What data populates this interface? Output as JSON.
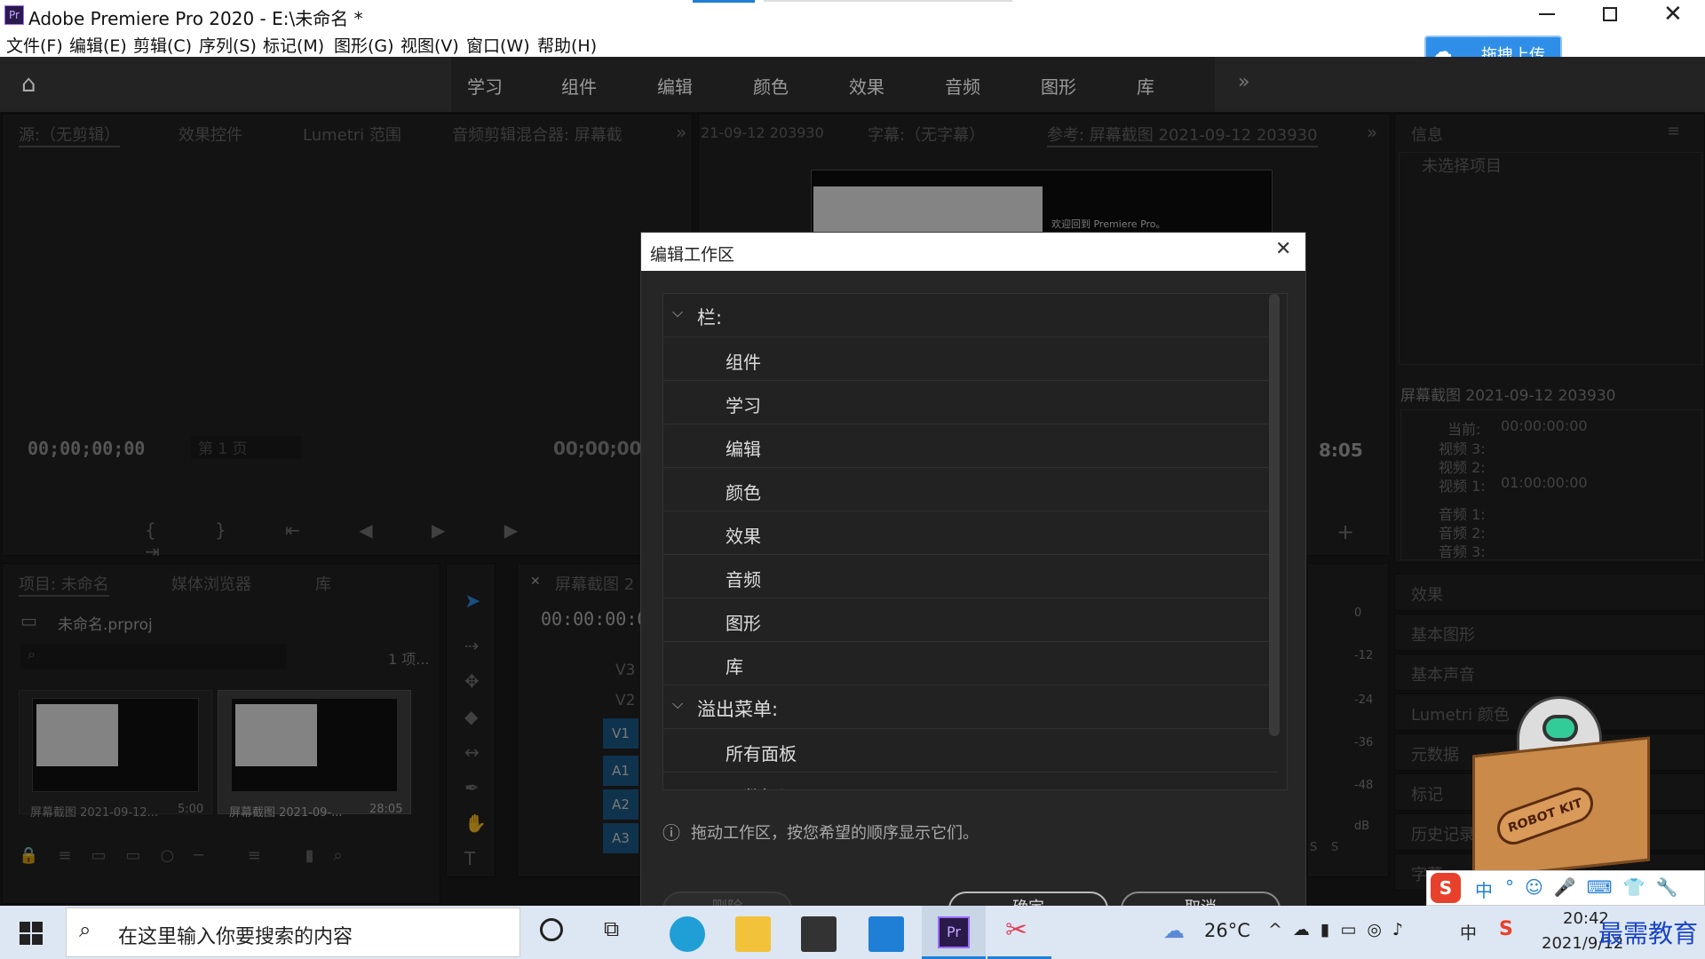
{
  "window": {
    "title": "Adobe Premiere Pro 2020 - E:\\未命名 *",
    "app_icon": "Pr"
  },
  "menu": [
    "文件(F)",
    "编辑(E)",
    "剪辑(C)",
    "序列(S)",
    "标记(M)",
    "图形(G)",
    "视图(V)",
    "窗口(W)",
    "帮助(H)"
  ],
  "upload_button": "拖拽上传",
  "workspaces": [
    "学习",
    "组件",
    "编辑",
    "颜色",
    "效果",
    "音频",
    "图形",
    "库"
  ],
  "source_panel": {
    "tabs": [
      "源:（无剪辑）",
      "效果控件",
      "Lumetri 范围",
      "音频剪辑混合器: 屏幕截"
    ],
    "tc_left": "00;00;00;00",
    "page": "第 1 页",
    "tc_right": "00;00;00;0"
  },
  "program_panel": {
    "tabs": [
      "21-09-12 203930",
      "字幕:（无字幕）",
      "参考: 屏幕截图 2021-09-12 203930"
    ],
    "tc_right": "8:05",
    "preview_text": "欢迎回到 Premiere Pro。"
  },
  "info_panel": {
    "title": "信息",
    "no_selection": "未选择项目",
    "clip_name": "屏幕截图 2021-09-12 203930",
    "current_label": "当前:",
    "current_value": "00:00:00:00",
    "video3": "视频 3:",
    "video2": "视频 2:",
    "video1": "视频 1:",
    "video1_value": "01:00:00:00",
    "audio1": "音频 1:",
    "audio2": "音频 2:",
    "audio3": "音频 3:"
  },
  "right_panels": [
    "效果",
    "基本图形",
    "基本声音",
    "Lumetri 颜色",
    "元数据",
    "标记",
    "历史记录",
    "字幕"
  ],
  "project_panel": {
    "tabs": [
      "项目: 未命名",
      "媒体浏览器",
      "库"
    ],
    "file": "未命名.prproj",
    "count": "1 项...",
    "thumb1_label": "屏幕截图 2021-09-12...",
    "thumb1_dur": "5:00",
    "thumb2_label": "屏幕截图 2021-09-...",
    "thumb2_dur": "28:05"
  },
  "timeline": {
    "tab": "屏幕截图 2",
    "tc": "00:00:00:0",
    "tracks": [
      "V3",
      "V2",
      "V1",
      "A1",
      "A2",
      "A3"
    ]
  },
  "meter": {
    "labels": [
      "0",
      "-12",
      "-24",
      "-36",
      "-48",
      "dB"
    ],
    "solo": [
      "S",
      "S"
    ]
  },
  "dialog": {
    "title": "编辑工作区",
    "bar_section": "栏:",
    "bar_items": [
      "组件",
      "学习",
      "编辑",
      "颜色",
      "效果",
      "音频",
      "图形",
      "库"
    ],
    "overflow_section": "溢出菜单:",
    "overflow_items": [
      "所有面板",
      "元数据记录"
    ],
    "hint": "拖动工作区，按您希望的顺序显示它们。",
    "delete": "删除",
    "ok": "确定",
    "cancel": "取消"
  },
  "taskbar": {
    "search_placeholder": "在这里输入你要搜索的内容",
    "temp": "26°C",
    "ime": "中",
    "time": "20:42",
    "date": "2021/9/12",
    "watermark": "最需教育"
  },
  "robot_box": "ROBOT KIT",
  "colors": {
    "accent_blue": "#1f7fd6",
    "track_blue": "#1c5c8c",
    "panel": "#232323"
  }
}
